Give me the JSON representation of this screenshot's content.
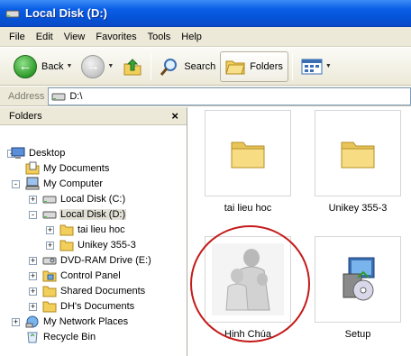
{
  "window": {
    "title": "Local Disk (D:)"
  },
  "menu": [
    "File",
    "Edit",
    "View",
    "Favorites",
    "Tools",
    "Help"
  ],
  "toolbar": {
    "back": "Back",
    "search": "Search",
    "folders": "Folders"
  },
  "address": {
    "label": "Address",
    "path": "D:\\"
  },
  "folders_pane": {
    "title": "Folders",
    "close": "×",
    "tree": [
      {
        "label": "Desktop",
        "icon": "desktop-icon",
        "expander": "minus"
      },
      {
        "label": "My Documents",
        "icon": "my-documents-icon",
        "expander": "none"
      },
      {
        "label": "My Computer",
        "icon": "my-computer-icon",
        "expander": "minus"
      },
      {
        "label": "Local Disk (C:)",
        "icon": "drive-icon",
        "expander": "plus"
      },
      {
        "label": "Local Disk (D:)",
        "icon": "drive-icon",
        "expander": "minus",
        "selected": true
      },
      {
        "label": "tai lieu hoc",
        "icon": "folder-icon",
        "expander": "plus"
      },
      {
        "label": "Unikey 355-3",
        "icon": "folder-icon",
        "expander": "plus"
      },
      {
        "label": "DVD-RAM Drive (E:)",
        "icon": "dvd-drive-icon",
        "expander": "plus"
      },
      {
        "label": "Control Panel",
        "icon": "control-panel-icon",
        "expander": "plus"
      },
      {
        "label": "Shared Documents",
        "icon": "folder-icon",
        "expander": "plus"
      },
      {
        "label": "DH's Documents",
        "icon": "folder-icon",
        "expander": "plus"
      },
      {
        "label": "My Network Places",
        "icon": "network-icon",
        "expander": "plus"
      },
      {
        "label": "Recycle Bin",
        "icon": "recycle-bin-icon",
        "expander": "none"
      }
    ]
  },
  "files": [
    {
      "name": "tai lieu hoc",
      "icon": "folder-icon"
    },
    {
      "name": "Unikey 355-3",
      "icon": "folder-icon"
    },
    {
      "name": "Hinh Chúa",
      "icon": "image-thumbnail"
    },
    {
      "name": "Setup",
      "icon": "setup-icon"
    }
  ],
  "colors": {
    "titlebar": "#0553d6",
    "menubar": "#ece9d8",
    "highlight_circle": "#c41a1a",
    "folder": "#f5d77a"
  }
}
